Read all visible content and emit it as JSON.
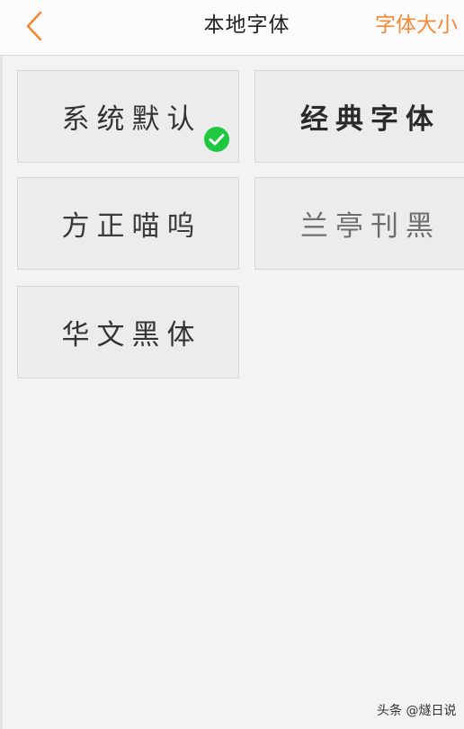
{
  "header": {
    "title": "本地字体",
    "font_size_label": "字体大小"
  },
  "fonts": [
    {
      "label": "系统默认",
      "selected": true
    },
    {
      "label": "经典字体",
      "selected": false
    },
    {
      "label": "方正喵呜",
      "selected": false
    },
    {
      "label": "兰亭刊黑",
      "selected": false
    },
    {
      "label": "华文黑体",
      "selected": false
    }
  ],
  "colors": {
    "accent": "#f28a35",
    "check_green": "#1ec940",
    "background": "#f3f3f3",
    "tile": "#ececec"
  },
  "watermark": "头条 @燧日说"
}
